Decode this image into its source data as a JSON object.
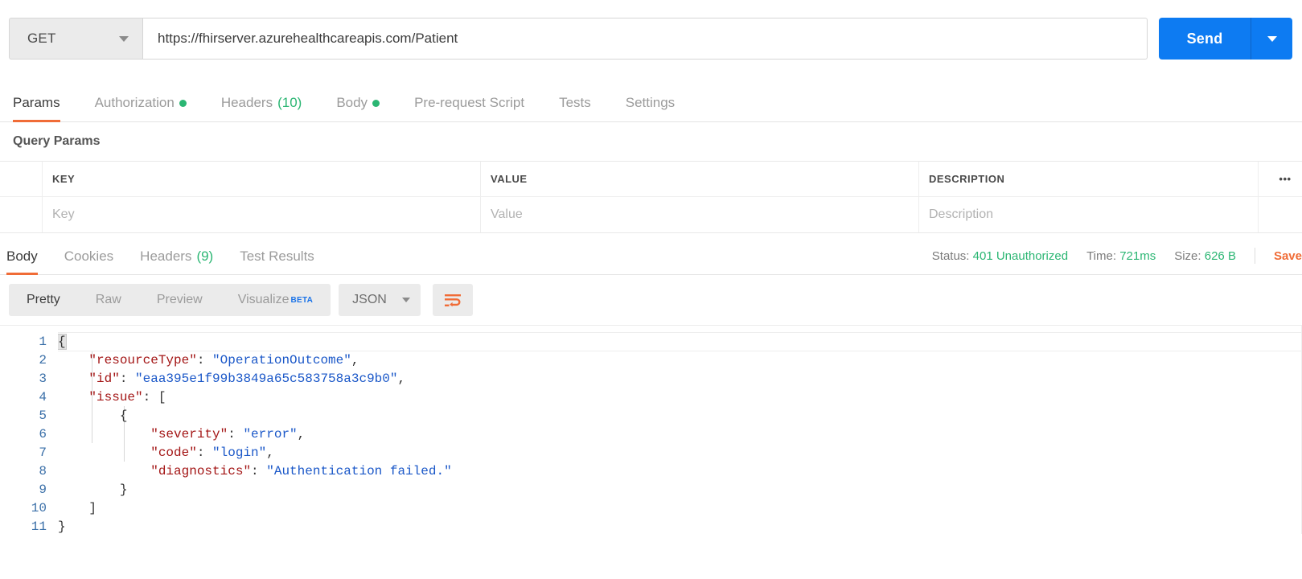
{
  "request": {
    "method": "GET",
    "url": "https://fhirserver.azurehealthcareapis.com/Patient",
    "send_label": "Send"
  },
  "request_tabs": [
    {
      "label": "Params",
      "active": true,
      "dot": false,
      "count": ""
    },
    {
      "label": "Authorization",
      "active": false,
      "dot": true,
      "count": ""
    },
    {
      "label": "Headers",
      "active": false,
      "dot": false,
      "count": "(10)"
    },
    {
      "label": "Body",
      "active": false,
      "dot": true,
      "count": ""
    },
    {
      "label": "Pre-request Script",
      "active": false,
      "dot": false,
      "count": ""
    },
    {
      "label": "Tests",
      "active": false,
      "dot": false,
      "count": ""
    },
    {
      "label": "Settings",
      "active": false,
      "dot": false,
      "count": ""
    }
  ],
  "query_params": {
    "title": "Query Params",
    "headers": {
      "key": "KEY",
      "value": "VALUE",
      "description": "DESCRIPTION"
    },
    "more_icon": "•••",
    "row": {
      "key": "Key",
      "value": "Value",
      "description": "Description"
    }
  },
  "response_tabs": [
    {
      "label": "Body",
      "active": true,
      "count": ""
    },
    {
      "label": "Cookies",
      "active": false,
      "count": ""
    },
    {
      "label": "Headers",
      "active": false,
      "count": "(9)"
    },
    {
      "label": "Test Results",
      "active": false,
      "count": ""
    }
  ],
  "response_meta": {
    "status_label": "Status:",
    "status_value": "401 Unauthorized",
    "time_label": "Time:",
    "time_value": "721ms",
    "size_label": "Size:",
    "size_value": "626 B",
    "save_label": "Save"
  },
  "view_toolbar": {
    "segments": [
      {
        "label": "Pretty",
        "active": true,
        "beta": ""
      },
      {
        "label": "Raw",
        "active": false,
        "beta": ""
      },
      {
        "label": "Preview",
        "active": false,
        "beta": ""
      },
      {
        "label": "Visualize",
        "active": false,
        "beta": "BETA"
      }
    ],
    "format": "JSON",
    "wrap_icon": "word-wrap-icon"
  },
  "body_code": {
    "line_numbers": [
      "1",
      "2",
      "3",
      "4",
      "5",
      "6",
      "7",
      "8",
      "9",
      "10",
      "11"
    ],
    "lines": [
      {
        "n": "1",
        "indent": 0,
        "parts": [
          {
            "t": "{",
            "c": "pun"
          }
        ]
      },
      {
        "n": "2",
        "indent": 1,
        "parts": [
          {
            "t": "\"resourceType\"",
            "c": "k"
          },
          {
            "t": ": ",
            "c": "pun"
          },
          {
            "t": "\"OperationOutcome\"",
            "c": "s"
          },
          {
            "t": ",",
            "c": "pun"
          }
        ]
      },
      {
        "n": "3",
        "indent": 1,
        "parts": [
          {
            "t": "\"id\"",
            "c": "k"
          },
          {
            "t": ": ",
            "c": "pun"
          },
          {
            "t": "\"eaa395e1f99b3849a65c583758a3c9b0\"",
            "c": "s"
          },
          {
            "t": ",",
            "c": "pun"
          }
        ]
      },
      {
        "n": "4",
        "indent": 1,
        "parts": [
          {
            "t": "\"issue\"",
            "c": "k"
          },
          {
            "t": ": [",
            "c": "pun"
          }
        ]
      },
      {
        "n": "5",
        "indent": 2,
        "parts": [
          {
            "t": "{",
            "c": "pun"
          }
        ]
      },
      {
        "n": "6",
        "indent": 3,
        "parts": [
          {
            "t": "\"severity\"",
            "c": "k"
          },
          {
            "t": ": ",
            "c": "pun"
          },
          {
            "t": "\"error\"",
            "c": "s"
          },
          {
            "t": ",",
            "c": "pun"
          }
        ]
      },
      {
        "n": "7",
        "indent": 3,
        "parts": [
          {
            "t": "\"code\"",
            "c": "k"
          },
          {
            "t": ": ",
            "c": "pun"
          },
          {
            "t": "\"login\"",
            "c": "s"
          },
          {
            "t": ",",
            "c": "pun"
          }
        ]
      },
      {
        "n": "8",
        "indent": 3,
        "parts": [
          {
            "t": "\"diagnostics\"",
            "c": "k"
          },
          {
            "t": ": ",
            "c": "pun"
          },
          {
            "t": "\"Authentication failed.\"",
            "c": "s"
          }
        ]
      },
      {
        "n": "9",
        "indent": 2,
        "parts": [
          {
            "t": "}",
            "c": "pun"
          }
        ]
      },
      {
        "n": "10",
        "indent": 1,
        "parts": [
          {
            "t": "]",
            "c": "pun"
          }
        ]
      },
      {
        "n": "11",
        "indent": 0,
        "parts": [
          {
            "t": "}",
            "c": "pun"
          }
        ]
      }
    ]
  },
  "colors": {
    "accent_orange": "#f06c37",
    "send_blue": "#0d7bf2",
    "status_green": "#2bb673",
    "json_key": "#a31515",
    "json_string": "#1a57c8",
    "beta_blue": "#1a73e8"
  }
}
